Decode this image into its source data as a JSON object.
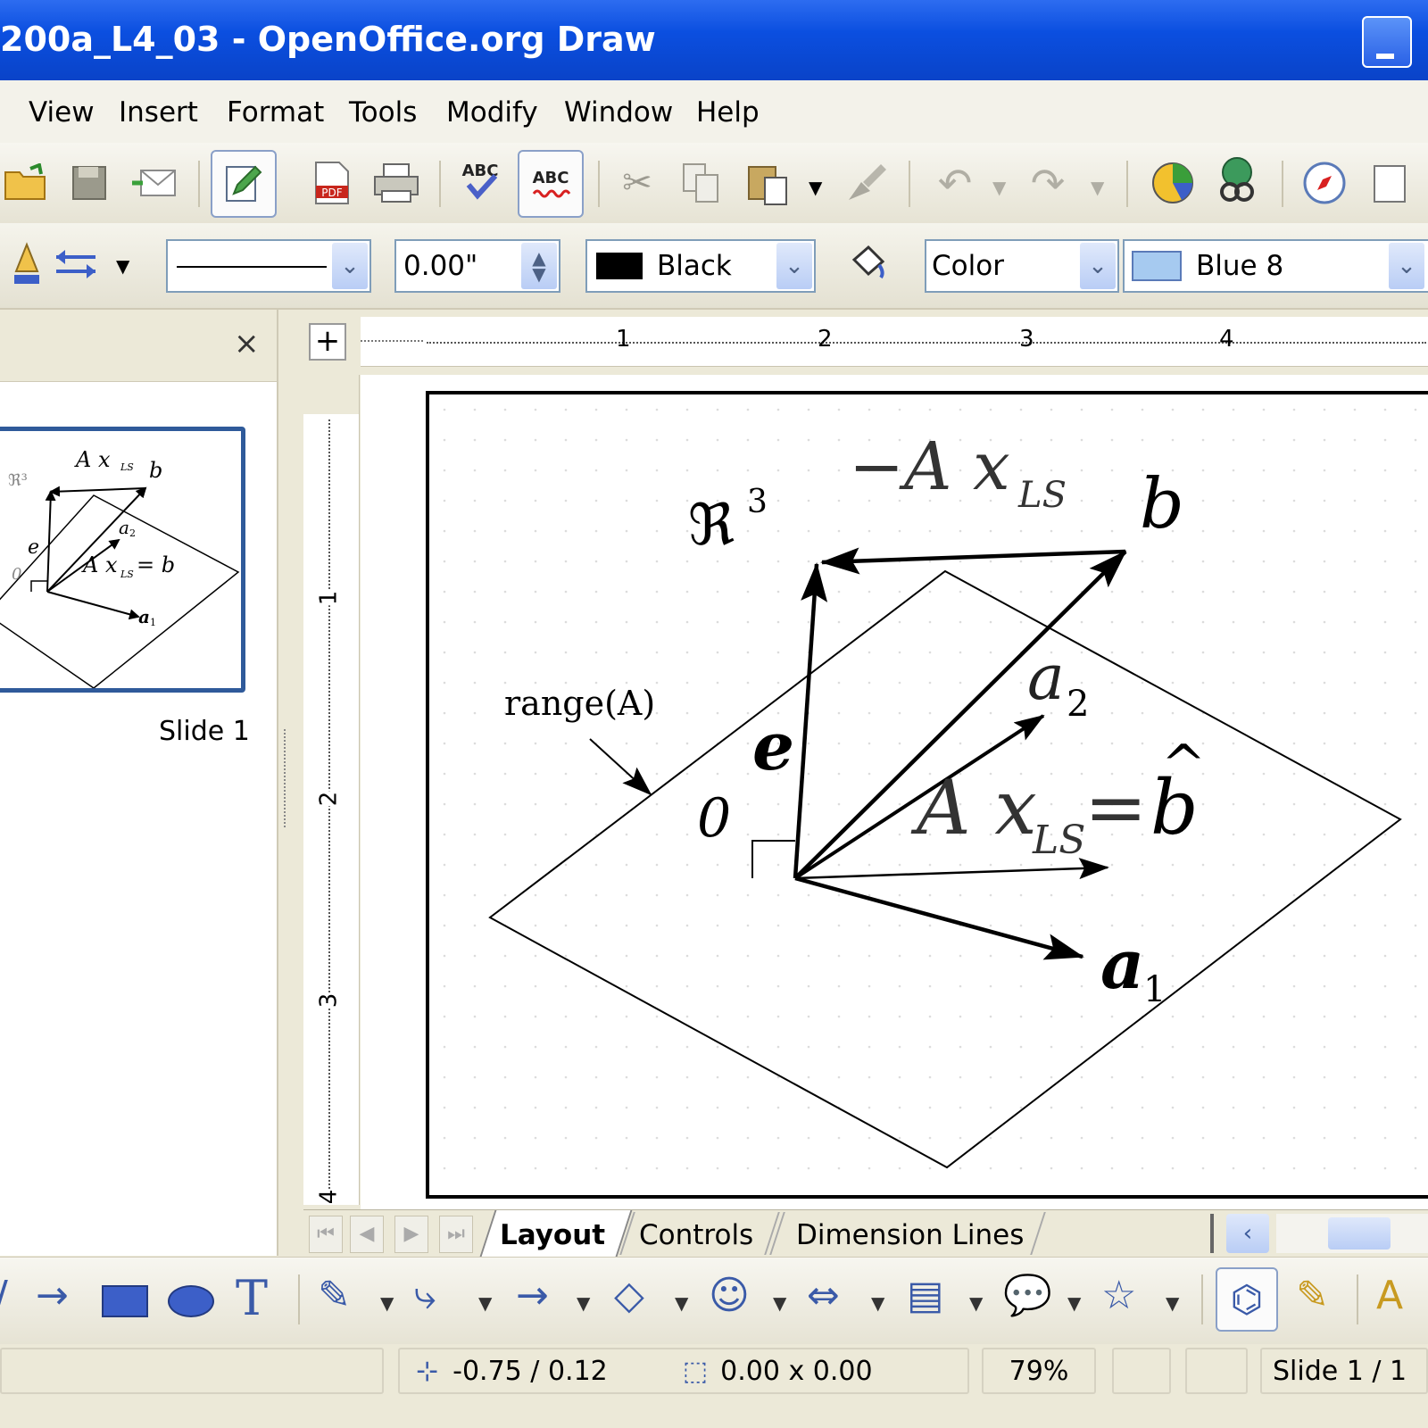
{
  "window": {
    "title": "200a_L4_03 - OpenOffice.org Draw"
  },
  "menu": [
    "View",
    "Insert",
    "Format",
    "Tools",
    "Modify",
    "Window",
    "Help"
  ],
  "line_toolbar": {
    "line_width": "0.00\"",
    "line_color": "Black",
    "area_style": "Color",
    "area_color": "Blue 8"
  },
  "slides_panel": {
    "close": "×",
    "slide_label": "Slide 1"
  },
  "rulers": {
    "horizontal": [
      "1",
      "2",
      "3",
      "4"
    ],
    "vertical": [
      "1",
      "2",
      "3",
      "4"
    ]
  },
  "drawing": {
    "r3_label": "ℜ",
    "r3_exp": "3",
    "minus_ax": "−A x",
    "ls": "LS",
    "b": "b",
    "a2": "a",
    "a2_sub": "2",
    "a1": "a",
    "a1_sub": "1",
    "e": "e",
    "zero": "0",
    "range": "range(A)",
    "ax_eq": "A x",
    "ax_eq_sub": "LS",
    "eq_sign": "=",
    "bhat": "b",
    "hat": "^"
  },
  "thumbnail": {
    "top_label": "A x",
    "top_sub": "LS",
    "b": "b",
    "r3": "ℜ³",
    "a2": "a",
    "a2_sub": "2",
    "e": "e",
    "zero": "0",
    "ax": "A x",
    "ax_sub": "LS",
    "eqb": "= b",
    "a1": "a",
    "a1_sub": "1"
  },
  "tabs": [
    "Layout",
    "Controls",
    "Dimension Lines"
  ],
  "status": {
    "position": "-0.75 / 0.12",
    "size": "0.00 x 0.00",
    "zoom": "79%",
    "slide": "Slide 1 / 1"
  },
  "colors": {
    "titlebar": "#0b4fe0",
    "chrome": "#ece9d8",
    "thumb_border": "#2f5a9a",
    "area_blue": "#a6caf0"
  }
}
